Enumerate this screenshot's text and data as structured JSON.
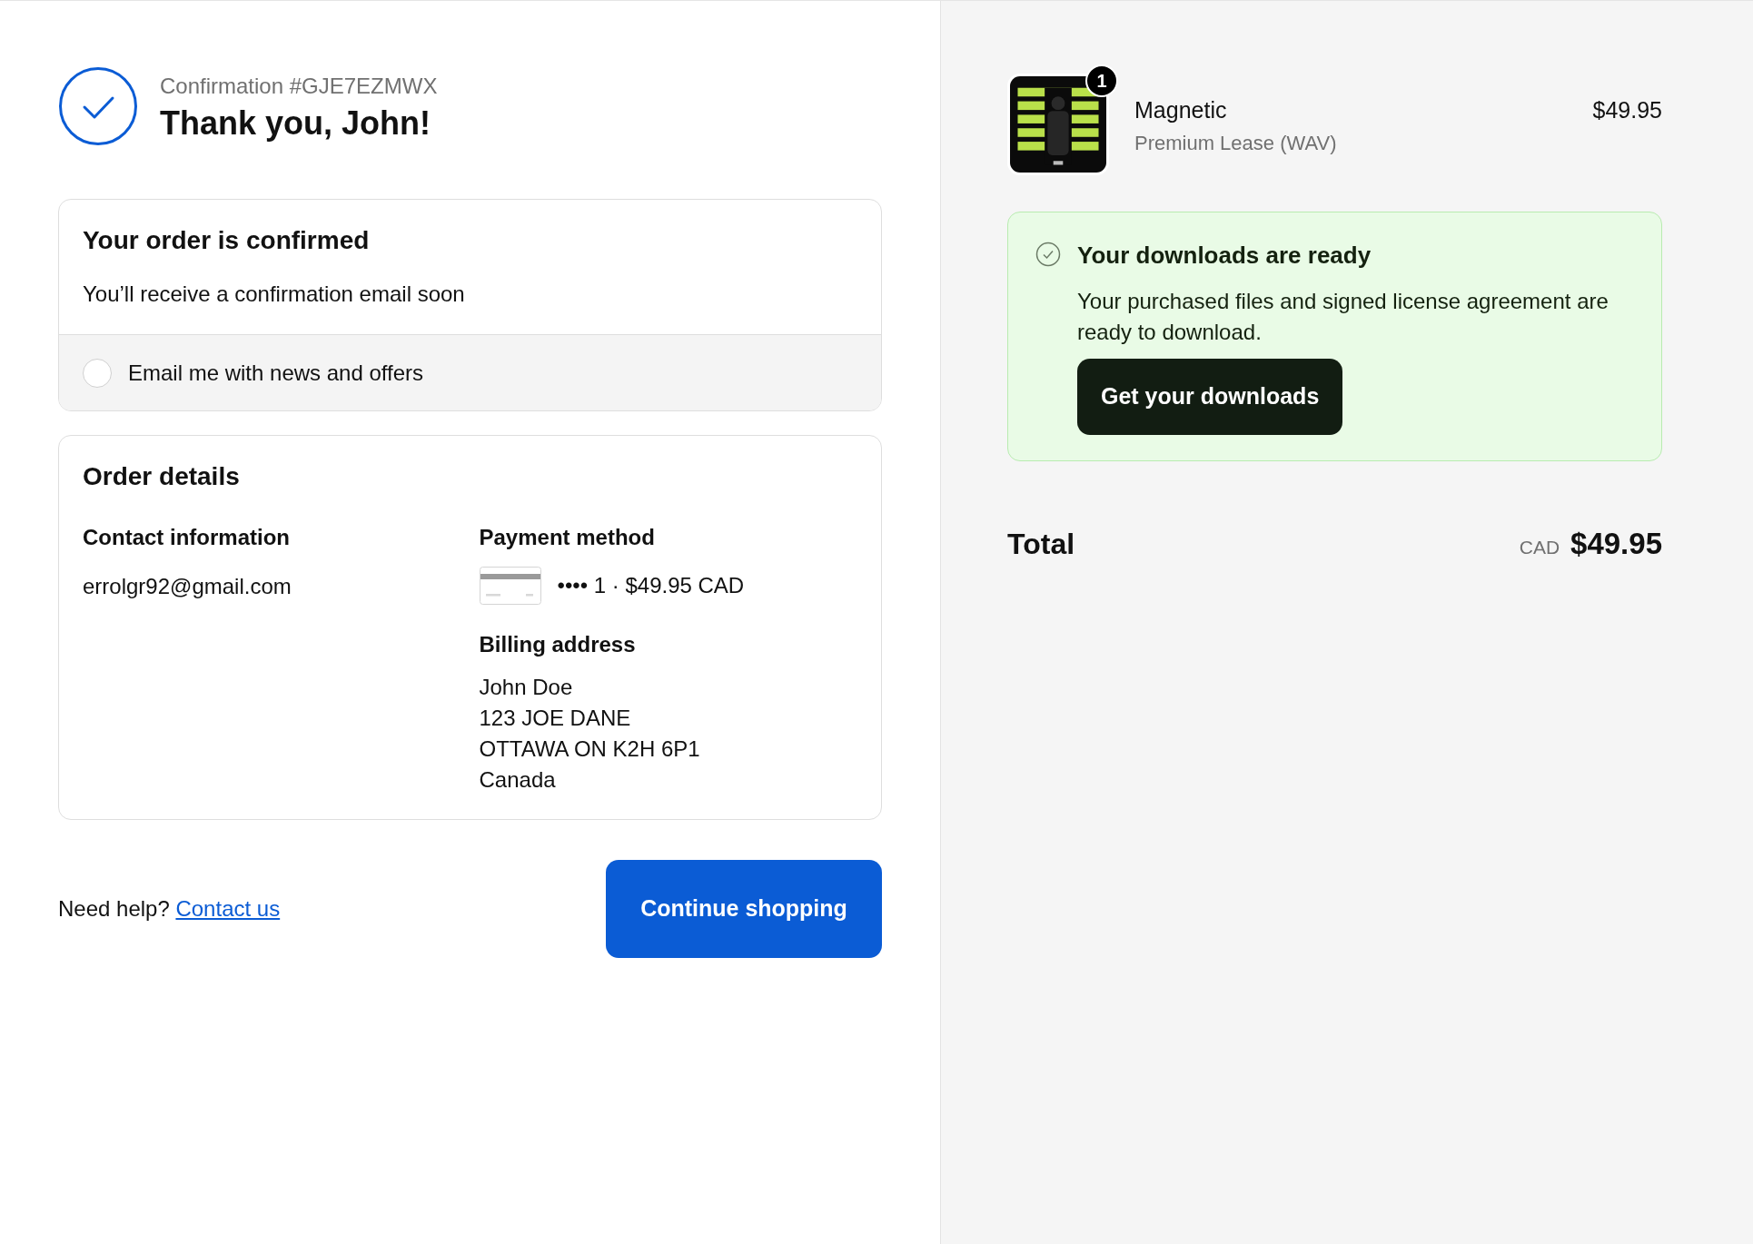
{
  "header": {
    "confirmation": "Confirmation #GJE7EZMWX",
    "title": "Thank you, John!"
  },
  "order_status": {
    "title": "Your order is confirmed",
    "message": "You’ll receive a confirmation email soon",
    "newsletter": {
      "label": "Email me with news and offers",
      "checked": false
    }
  },
  "order_details": {
    "title": "Order details",
    "contact": {
      "heading": "Contact information",
      "email": "errolgr92@gmail.com"
    },
    "payment": {
      "heading": "Payment method",
      "card": "•••• 1 · $49.95 CAD"
    },
    "billing": {
      "heading": "Billing address",
      "lines": [
        "John Doe",
        "123 JOE DANE",
        "OTTAWA ON K2H 6P1",
        "Canada"
      ]
    }
  },
  "footer": {
    "help": "Need help?",
    "link": "Contact us",
    "button": "Continue shopping"
  },
  "cart": {
    "items": [
      {
        "name": "Magnetic",
        "variant": "Premium Lease (WAV)",
        "price": "$49.95",
        "quantity": "1"
      }
    ]
  },
  "downloads": {
    "title": "Your downloads are ready",
    "message": "Your purchased files and signed license agreement are ready to download.",
    "button": "Get your downloads"
  },
  "total": {
    "label": "Total",
    "currency": "CAD",
    "amount": "$49.95"
  }
}
